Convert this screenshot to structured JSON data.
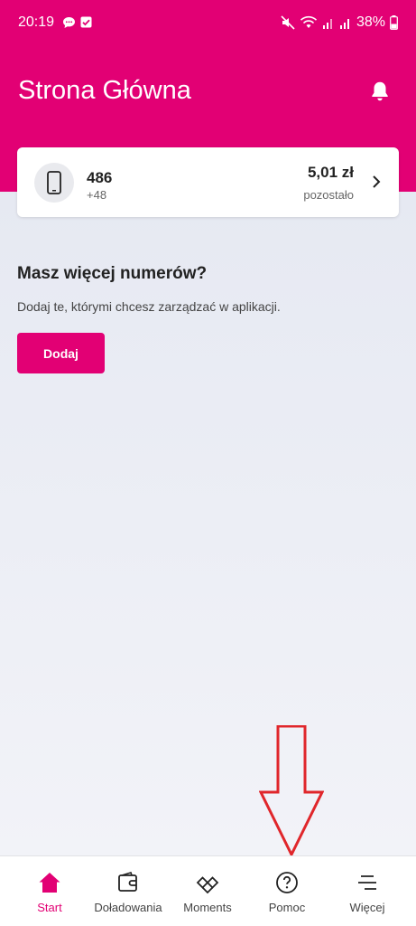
{
  "status_bar": {
    "time": "20:19",
    "battery": "38%"
  },
  "header": {
    "title": "Strona Główna"
  },
  "account": {
    "number": "486",
    "prefix": "+48",
    "balance": "5,01 zł",
    "balance_label": "pozostało"
  },
  "more_numbers": {
    "title": "Masz więcej numerów?",
    "description": "Dodaj te, którymi chcesz zarządzać w aplikacji.",
    "button_label": "Dodaj"
  },
  "bottom_nav": {
    "items": [
      {
        "label": "Start",
        "icon": "home-icon",
        "active": true
      },
      {
        "label": "Doładowania",
        "icon": "wallet-icon",
        "active": false
      },
      {
        "label": "Moments",
        "icon": "moments-icon",
        "active": false
      },
      {
        "label": "Pomoc",
        "icon": "help-icon",
        "active": false
      },
      {
        "label": "Więcej",
        "icon": "menu-icon",
        "active": false
      }
    ]
  },
  "colors": {
    "brand": "#e20074",
    "annotation_arrow": "#e0262b"
  }
}
